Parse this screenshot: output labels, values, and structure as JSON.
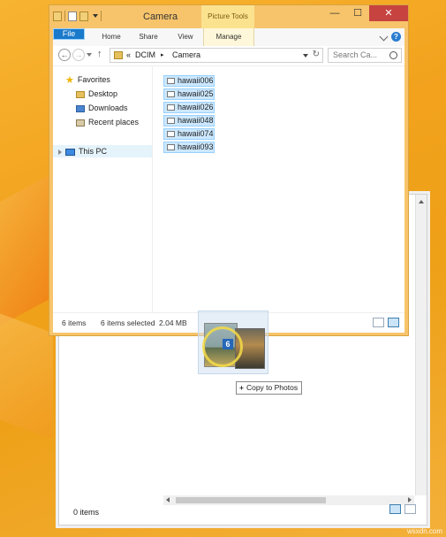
{
  "window": {
    "title": "Camera",
    "context_tab_group": "Picture Tools",
    "buttons": {
      "minimize": "—",
      "maximize": "☐",
      "close": "✕"
    },
    "ribbon_tabs": [
      "File",
      "Home",
      "Share",
      "View",
      "Manage"
    ],
    "help": "?"
  },
  "address": {
    "prefix": "«",
    "crumbs": [
      "DCIM",
      "Camera"
    ],
    "separator": "▸",
    "search_placeholder": "Search Ca..."
  },
  "nav_pane": {
    "favorites_label": "Favorites",
    "favorites": [
      "Desktop",
      "Downloads",
      "Recent places"
    ],
    "this_pc": "This PC"
  },
  "files": [
    "hawaii006",
    "hawaii025",
    "hawaii026",
    "hawaii048",
    "hawaii074",
    "hawaii093"
  ],
  "status": {
    "items": "6 items",
    "selected": "6 items selected",
    "size": "2.04 MB"
  },
  "back_window": {
    "status": "0 items"
  },
  "drag": {
    "count": "6",
    "tooltip": "Copy to Photos"
  },
  "watermark": "wsxdn.com",
  "colors": {
    "desktop": "#f2a21d",
    "window_frame": "#f7c46b",
    "file_tab": "#1979ca",
    "selection": "#cce8ff",
    "close": "#c7433f"
  }
}
